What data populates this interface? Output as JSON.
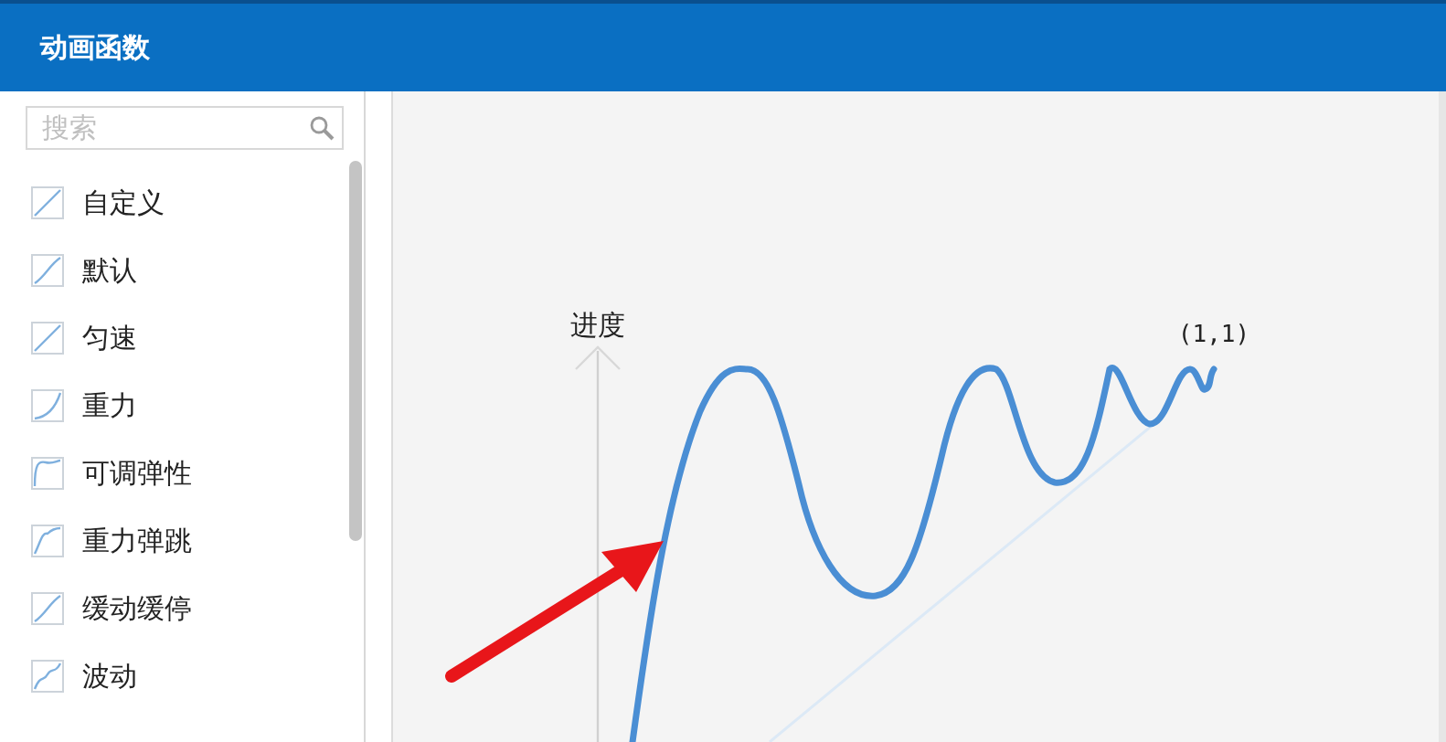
{
  "window": {
    "title": "动画函数"
  },
  "search": {
    "placeholder": "搜索"
  },
  "easing_list": [
    {
      "label": "自定义",
      "kind": "linear"
    },
    {
      "label": "默认",
      "kind": "ease"
    },
    {
      "label": "匀速",
      "kind": "linear"
    },
    {
      "label": "重力",
      "kind": "gravity"
    },
    {
      "label": "可调弹性",
      "kind": "elastic"
    },
    {
      "label": "重力弹跳",
      "kind": "bounce"
    },
    {
      "label": "缓动缓停",
      "kind": "ease"
    },
    {
      "label": "波动",
      "kind": "wave"
    }
  ],
  "preview": {
    "axis_label": "进度",
    "end_label": "(1,1)"
  }
}
